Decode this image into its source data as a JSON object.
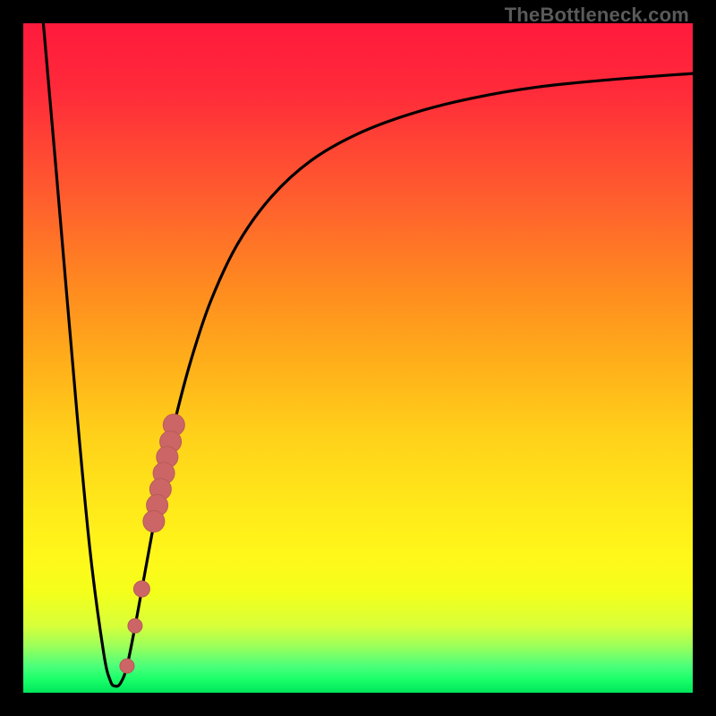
{
  "watermark": "TheBottleneck.com",
  "colors": {
    "background": "#000000",
    "curve": "#000000",
    "marker_fill": "#cc6666",
    "marker_stroke": "#b85a5a"
  },
  "chart_data": {
    "type": "line",
    "title": "",
    "xlabel": "",
    "ylabel": "",
    "xlim": [
      0,
      1
    ],
    "ylim": [
      0,
      1
    ],
    "series": [
      {
        "name": "bottleneck-curve",
        "x": [
          0.03,
          0.05,
          0.08,
          0.1,
          0.12,
          0.13,
          0.137,
          0.145,
          0.155,
          0.17,
          0.19,
          0.21,
          0.225,
          0.25,
          0.28,
          0.32,
          0.37,
          0.43,
          0.5,
          0.58,
          0.67,
          0.77,
          0.88,
          1.0
        ],
        "values": [
          1.0,
          0.77,
          0.42,
          0.21,
          0.06,
          0.018,
          0.01,
          0.014,
          0.04,
          0.115,
          0.225,
          0.33,
          0.4,
          0.495,
          0.585,
          0.67,
          0.74,
          0.795,
          0.835,
          0.865,
          0.888,
          0.905,
          0.916,
          0.925
        ]
      }
    ],
    "markers": [
      {
        "name": "marker-cluster-top",
        "x": 0.225,
        "y": 0.4,
        "r": 12
      },
      {
        "name": "marker-cluster-2",
        "x": 0.22,
        "y": 0.375,
        "r": 12
      },
      {
        "name": "marker-cluster-3",
        "x": 0.215,
        "y": 0.352,
        "r": 12
      },
      {
        "name": "marker-cluster-4",
        "x": 0.21,
        "y": 0.328,
        "r": 12
      },
      {
        "name": "marker-cluster-5",
        "x": 0.205,
        "y": 0.304,
        "r": 12
      },
      {
        "name": "marker-cluster-6",
        "x": 0.2,
        "y": 0.28,
        "r": 12
      },
      {
        "name": "marker-cluster-bottom",
        "x": 0.195,
        "y": 0.256,
        "r": 12
      },
      {
        "name": "marker-gap-upper",
        "x": 0.177,
        "y": 0.155,
        "r": 9
      },
      {
        "name": "marker-gap-lower",
        "x": 0.167,
        "y": 0.1,
        "r": 8
      },
      {
        "name": "marker-near-min",
        "x": 0.155,
        "y": 0.04,
        "r": 8
      }
    ]
  }
}
